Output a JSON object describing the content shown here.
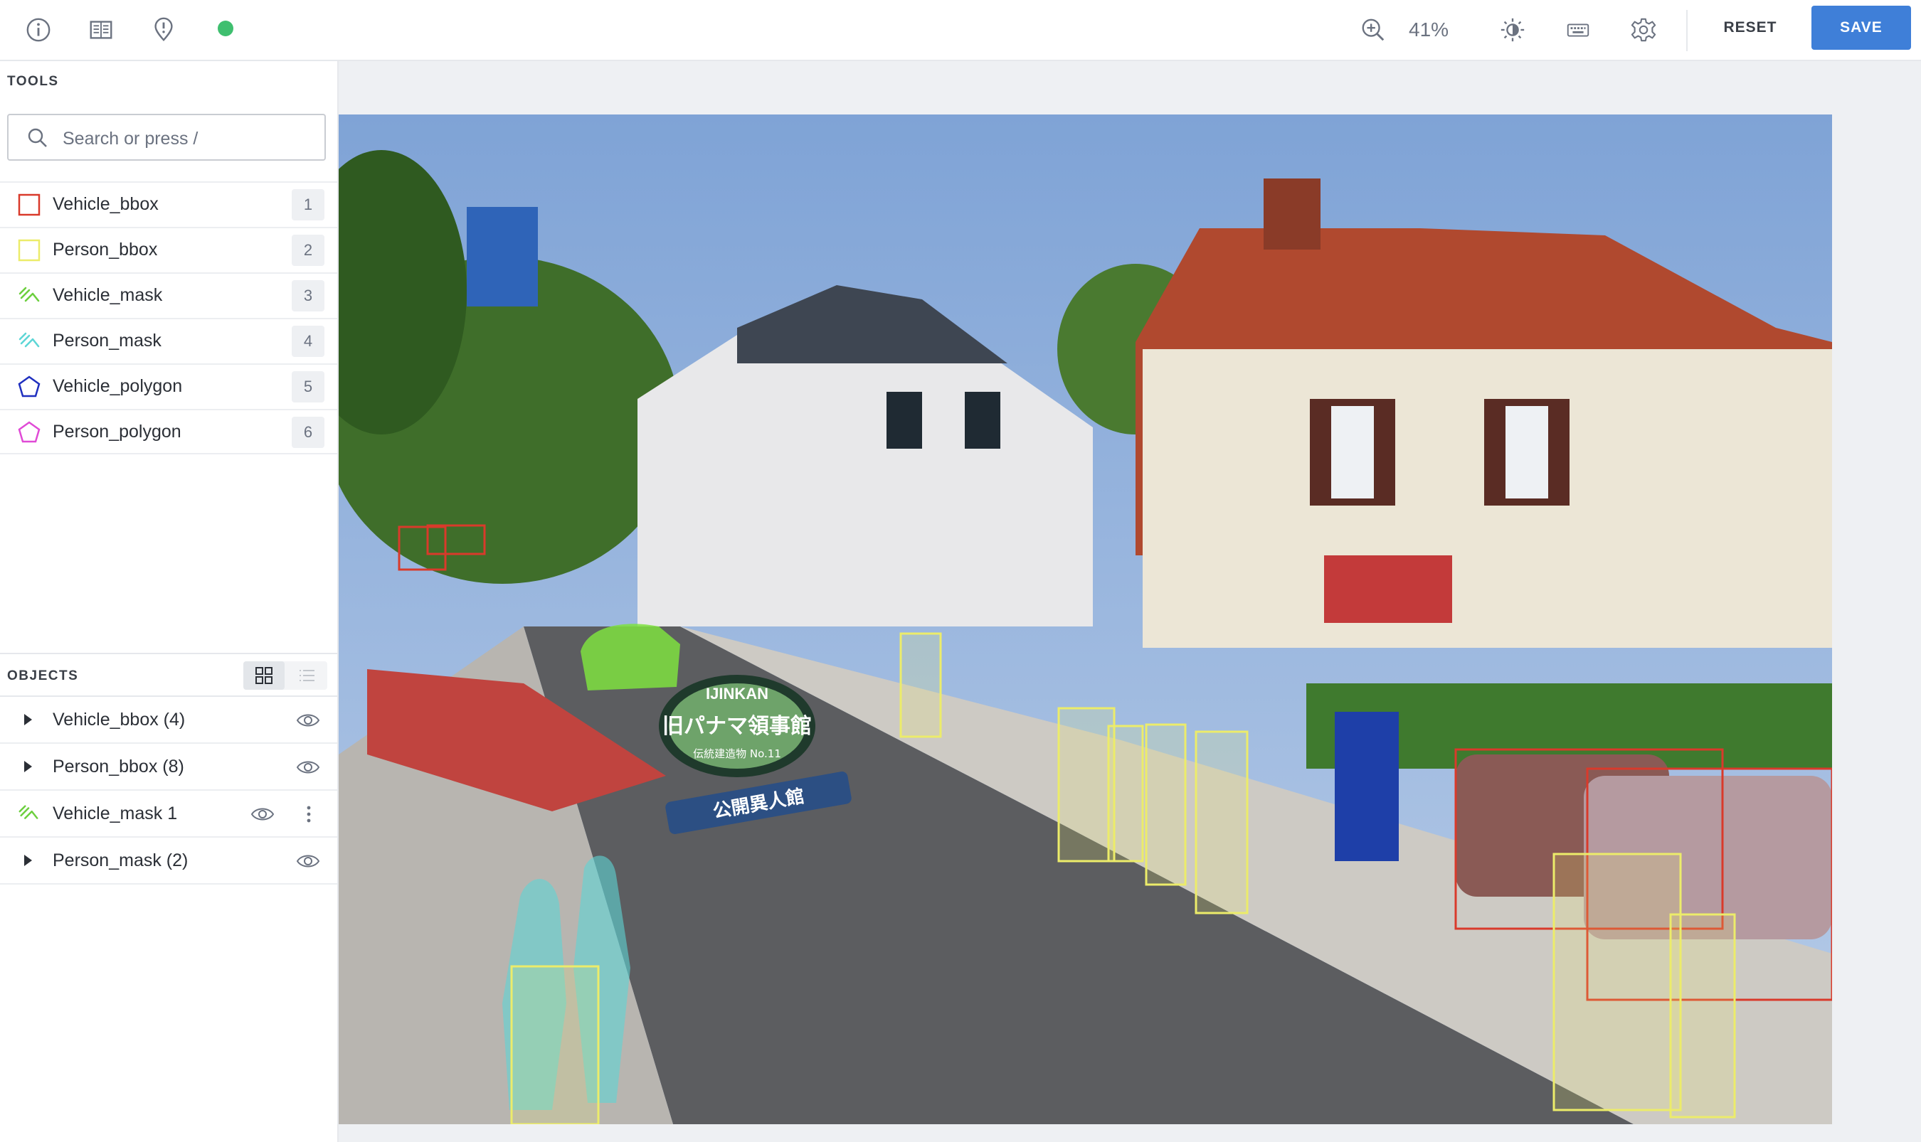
{
  "toolbar": {
    "zoom": "41%",
    "reset_label": "RESET",
    "save_label": "SAVE",
    "save_color": "#3f7fd8",
    "status_color": "#3fbf6f",
    "icons": [
      "info-icon",
      "panel-layout-icon",
      "issue-marker-icon",
      "zoom-in-icon",
      "brightness-icon",
      "keyboard-icon",
      "gear-icon"
    ]
  },
  "tools": {
    "title": "TOOLS",
    "search_placeholder": "Search or press /",
    "items": [
      {
        "label": "Vehicle_bbox",
        "hotkey": "1",
        "icon": "rectangle-icon",
        "color": "#d93a2b"
      },
      {
        "label": "Person_bbox",
        "hotkey": "2",
        "icon": "rectangle-icon",
        "color": "#ecec6a"
      },
      {
        "label": "Vehicle_mask",
        "hotkey": "3",
        "icon": "brush-icon",
        "color": "#6ccf3e"
      },
      {
        "label": "Person_mask",
        "hotkey": "4",
        "icon": "brush-icon",
        "color": "#5ed6d6"
      },
      {
        "label": "Vehicle_polygon",
        "hotkey": "5",
        "icon": "polygon-icon",
        "color": "#1f2fbf"
      },
      {
        "label": "Person_polygon",
        "hotkey": "6",
        "icon": "polygon-icon",
        "color": "#e04ad6"
      }
    ]
  },
  "objects": {
    "title": "OBJECTS",
    "items": [
      {
        "label": "Vehicle_bbox (4)"
      },
      {
        "label": "Person_bbox (8)"
      },
      {
        "label": "Vehicle_mask 1"
      },
      {
        "label": "Person_mask (2)"
      }
    ]
  },
  "canvas": {
    "background": "#eef0f3",
    "shop_sign_lines": [
      "IJINKAN",
      "旧パナマ領事館",
      "伝統建造物 No.11"
    ],
    "banner_text": "公開異人館"
  }
}
